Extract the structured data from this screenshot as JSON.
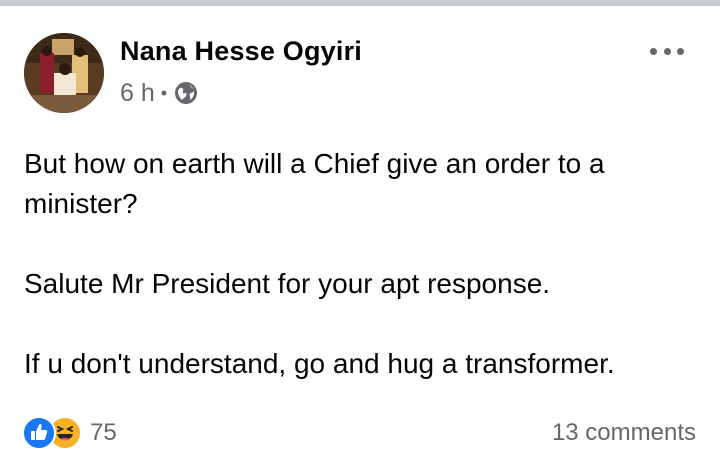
{
  "post": {
    "author": "Nana Hesse Ogyiri",
    "time": "6 h",
    "separator": "•",
    "privacy_icon": "globe-icon",
    "more_icon": "more-options-icon",
    "paragraphs": [
      "But how on earth will a Chief give an order to a minister?",
      "Salute Mr President for your apt response.",
      "If u don't understand, go and hug a transformer."
    ],
    "reactions": {
      "icons": [
        "like-icon",
        "haha-icon"
      ],
      "count": "75"
    },
    "comments": "13 comments"
  },
  "colors": {
    "text": "#050505",
    "secondary_text": "#65676b",
    "like_blue": "#1877f2",
    "haha_yellow": "#f7b125",
    "divider": "#c9ccd1"
  }
}
